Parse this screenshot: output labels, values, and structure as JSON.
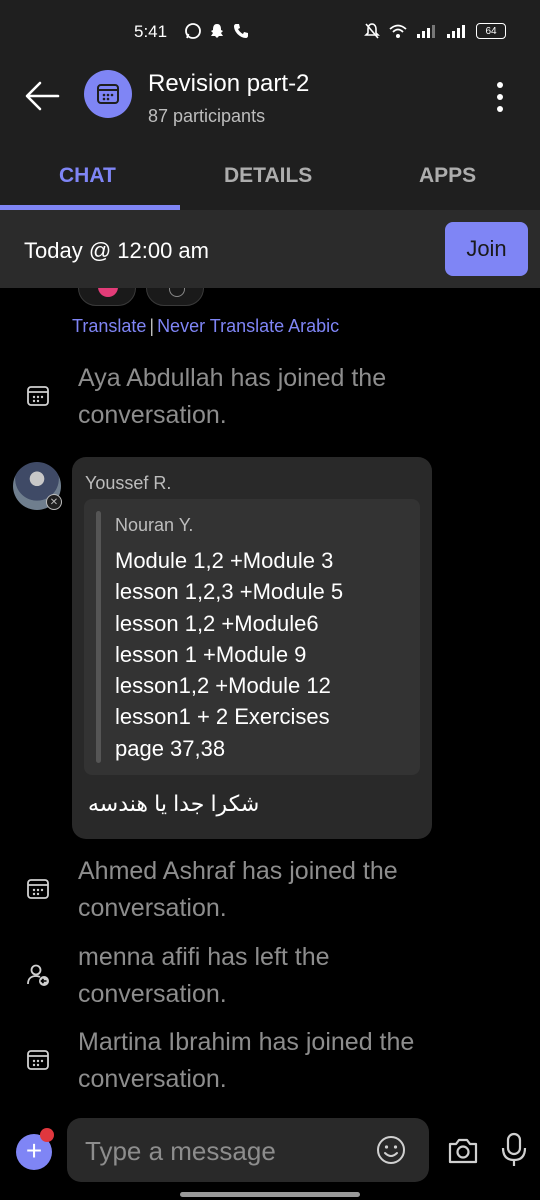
{
  "status_bar": {
    "time": "5:41",
    "battery": "64"
  },
  "header": {
    "title": "Revision part-2",
    "subtitle": "87 participants"
  },
  "tabs": {
    "chat": "CHAT",
    "details": "DETAILS",
    "apps": "APPS"
  },
  "meeting": {
    "time_label": "Today @ 12:00 am",
    "join_label": "Join"
  },
  "translate": {
    "translate_label": "Translate",
    "separator": "|",
    "never_label": "Never Translate Arabic"
  },
  "system_messages": [
    {
      "text": "Aya Abdullah has joined the conversation.",
      "icon": "calendar-icon"
    },
    {
      "text": "Ahmed Ashraf has joined the conversation.",
      "icon": "calendar-icon"
    },
    {
      "text": "menna afifi has left the conversation.",
      "icon": "person-left-icon"
    },
    {
      "text": "Martina Ibrahim has joined the conversation.",
      "icon": "calendar-icon"
    }
  ],
  "message": {
    "sender": "Youssef R.",
    "quote_sender": "Nouran Y.",
    "quote_text": "Module 1,2 +Module 3 lesson 1,2,3 +Module 5 lesson 1,2 +Module6 lesson 1 +Module 9 lesson1,2 +Module 12 lesson1 + 2 Exercises page 37,38",
    "text": "شكرا جدا يا هندسه"
  },
  "compose": {
    "placeholder": "Type a message"
  },
  "colors": {
    "accent": "#7f85f5",
    "background": "#000000",
    "header_bg": "#1f1f1f",
    "bubble_bg": "#292929",
    "system_text": "#8d8d8d",
    "badge": "#e0373e"
  }
}
